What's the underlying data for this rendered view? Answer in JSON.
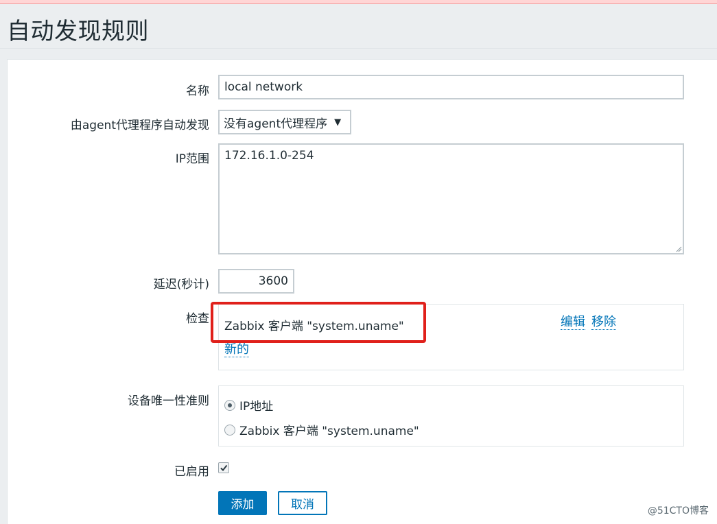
{
  "page": {
    "title": "自动发现规则"
  },
  "form": {
    "name": {
      "label": "名称",
      "value": "local network"
    },
    "proxy": {
      "label": "由agent代理程序自动发现",
      "selected": "没有agent代理程序"
    },
    "ip_range": {
      "label": "IP范围",
      "value": "172.16.1.0-254"
    },
    "delay": {
      "label": "延迟(秒计)",
      "value": "3600"
    },
    "checks": {
      "label": "检查",
      "items": [
        {
          "name": "Zabbix 客户端 \"system.uname\"",
          "edit": "编辑",
          "remove": "移除"
        }
      ],
      "new_link": "新的"
    },
    "uniqueness": {
      "label": "设备唯一性准则",
      "options": [
        {
          "label": "IP地址",
          "checked": true
        },
        {
          "label": "Zabbix 客户端 \"system.uname\"",
          "checked": false
        }
      ]
    },
    "enabled": {
      "label": "已启用",
      "checked": true
    }
  },
  "buttons": {
    "add": "添加",
    "cancel": "取消"
  },
  "watermark": "@51CTO博客",
  "colors": {
    "accent": "#0275b8",
    "highlight": "#e0201b"
  }
}
